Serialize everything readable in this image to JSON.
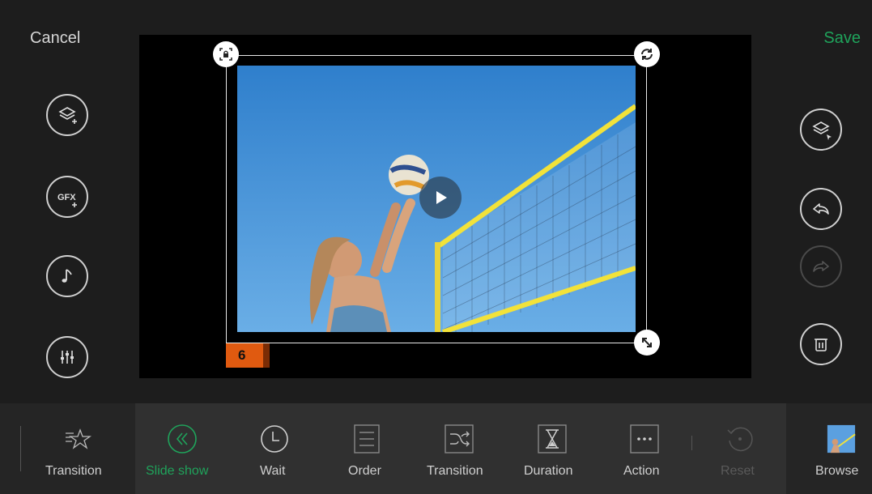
{
  "header": {
    "cancel_label": "Cancel",
    "save_label": "Save"
  },
  "colors": {
    "accent_green": "#1fa35b",
    "slide_badge": "#e05a10",
    "background": "#1d1d1d"
  },
  "left_tools": [
    {
      "name": "add-layer",
      "icon": "layers-plus-icon"
    },
    {
      "name": "add-gfx",
      "icon": "gfx-plus-icon"
    },
    {
      "name": "music",
      "icon": "music-note-icon"
    },
    {
      "name": "audio-mixer",
      "icon": "sliders-icon"
    }
  ],
  "right_tools": [
    {
      "name": "select-layer",
      "icon": "layers-cursor-icon"
    },
    {
      "name": "undo",
      "icon": "undo-icon"
    },
    {
      "name": "redo",
      "icon": "redo-icon",
      "disabled": true
    },
    {
      "name": "delete",
      "icon": "trash-icon"
    }
  ],
  "preview": {
    "slide_number": "6",
    "image_subject": "volleyball"
  },
  "toolbar": {
    "items": [
      {
        "label": "Transition",
        "icon": "star-lines-icon"
      },
      {
        "label": "Slide show",
        "icon": "double-chevron-left-icon",
        "active": true
      },
      {
        "label": "Wait",
        "icon": "clock-icon"
      },
      {
        "label": "Order",
        "icon": "list-icon"
      },
      {
        "label": "Transition",
        "icon": "shuffle-icon"
      },
      {
        "label": "Duration",
        "icon": "hourglass-icon"
      },
      {
        "label": "Action",
        "icon": "dots-icon"
      },
      {
        "label": "Reset",
        "icon": "reset-icon",
        "disabled": true
      },
      {
        "label": "Browse",
        "icon": "photo-thumbnail-icon"
      }
    ]
  }
}
